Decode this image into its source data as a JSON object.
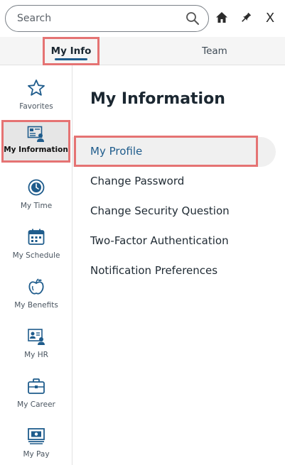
{
  "search": {
    "placeholder": "Search"
  },
  "header_icons": [
    "search-icon",
    "home-icon",
    "pin-icon",
    "close-icon"
  ],
  "close_label": "X",
  "tabs": [
    {
      "label": "My Info",
      "active": true
    },
    {
      "label": "Team",
      "active": false
    }
  ],
  "sidebar": {
    "items": [
      {
        "label": "Favorites",
        "icon": "star-icon"
      },
      {
        "label": "My Information",
        "icon": "id-card-icon",
        "active": true
      },
      {
        "label": "My Time",
        "icon": "clock-icon"
      },
      {
        "label": "My Schedule",
        "icon": "calendar-icon"
      },
      {
        "label": "My Benefits",
        "icon": "apple-icon"
      },
      {
        "label": "My HR",
        "icon": "hr-profile-icon"
      },
      {
        "label": "My Career",
        "icon": "briefcase-icon"
      },
      {
        "label": "My Pay",
        "icon": "pay-icon"
      }
    ]
  },
  "main": {
    "title": "My Information",
    "items": [
      {
        "label": "My Profile",
        "selected": true
      },
      {
        "label": "Change Password"
      },
      {
        "label": "Change Security Question"
      },
      {
        "label": "Two-Factor Authentication"
      },
      {
        "label": "Notification Preferences"
      }
    ]
  },
  "colors": {
    "accent": "#1f5c8c",
    "highlight": "#e57373",
    "icon": "#1f5c8c"
  }
}
